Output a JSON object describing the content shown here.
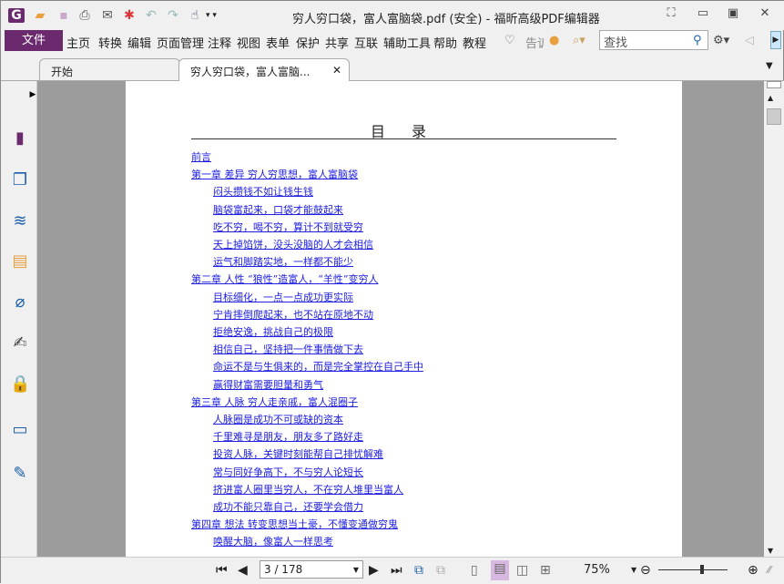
{
  "window": {
    "title": "穷人穷口袋，富人富脑袋.pdf (安全) - 福昕高级PDF编辑器"
  },
  "menu": {
    "file": "文件",
    "items": [
      "主页",
      "转换",
      "编辑",
      "页面管理",
      "注释",
      "视图",
      "表单",
      "保护",
      "共享",
      "互联",
      "辅助工具",
      "帮助",
      "教程"
    ],
    "tell": "告诉",
    "search_placeholder": "查找"
  },
  "tabs": [
    {
      "label": "开始"
    },
    {
      "label": "穷人穷口袋，富人富脑..."
    }
  ],
  "document": {
    "toc_title": "目 录",
    "entries": [
      {
        "text": "前言",
        "level": 0
      },
      {
        "text": "第一章 差异 穷人穷思想，富人富脑袋",
        "level": 0
      },
      {
        "text": "闷头攒钱不如让钱生钱",
        "level": 1
      },
      {
        "text": "脑袋富起来，口袋才能鼓起来",
        "level": 1
      },
      {
        "text": "吃不穷，喝不穷，算计不到就受穷",
        "level": 1
      },
      {
        "text": "天上掉馅饼，没头没脑的人才会相信",
        "level": 1
      },
      {
        "text": "运气和脚踏实地，一样都不能少",
        "level": 1
      },
      {
        "text": "第二章 人性 “狼性”造富人，“羊性”变穷人",
        "level": 0
      },
      {
        "text": "目标细化，一点一点成功更实际",
        "level": 1
      },
      {
        "text": "宁肯摔倒爬起来，也不站在原地不动",
        "level": 1
      },
      {
        "text": "拒绝安逸，挑战自己的极限",
        "level": 1
      },
      {
        "text": "相信自己，坚持把一件事情做下去",
        "level": 1
      },
      {
        "text": "命运不是与生俱来的，而是完全掌控在自己手中",
        "level": 1
      },
      {
        "text": "赢得财富需要胆量和勇气",
        "level": 1
      },
      {
        "text": "第三章 人脉 穷人走亲戚，富人混圈子",
        "level": 0
      },
      {
        "text": "人脉圈是成功不可或缺的资本",
        "level": 1
      },
      {
        "text": "千里难寻是朋友，朋友多了路好走",
        "level": 1
      },
      {
        "text": "投资人脉，关键时刻能帮自己排忧解难",
        "level": 1
      },
      {
        "text": "常与同好争高下，不与穷人论短长",
        "level": 1
      },
      {
        "text": "挤进富人圈里当穷人，不在穷人堆里当富人",
        "level": 1
      },
      {
        "text": "成功不能只靠自己，还要学会借力",
        "level": 1
      },
      {
        "text": "第四章 想法 转变思想当土豪，不懂变通做穷鬼",
        "level": 0
      },
      {
        "text": "唤醒大脑，像富人一样思考",
        "level": 1
      }
    ]
  },
  "status": {
    "page": "3 / 178",
    "zoom": "75%",
    "zoom_fraction": 0.6
  },
  "colors": {
    "brand": "#6b2a6e",
    "link": "#2020e0"
  }
}
